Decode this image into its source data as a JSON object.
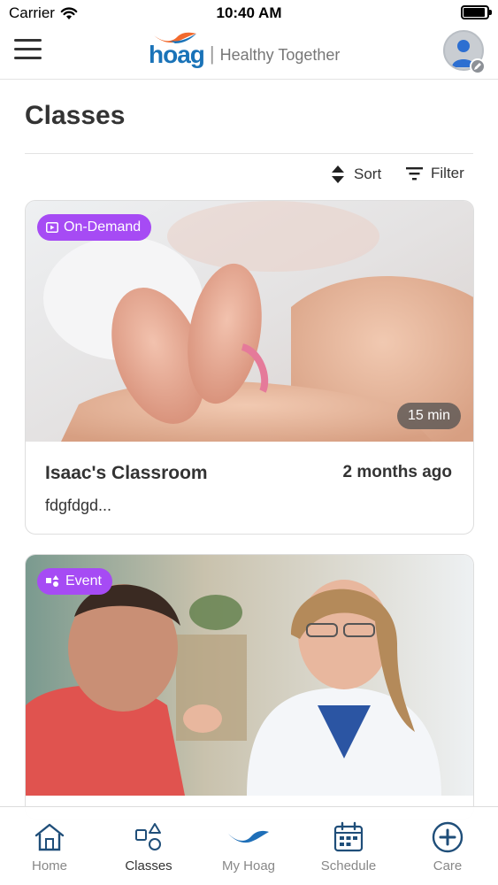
{
  "status_bar": {
    "carrier": "Carrier",
    "time": "10:40 AM"
  },
  "header": {
    "brand_name": "hoag",
    "brand_divider": "|",
    "tagline": "Healthy Together",
    "icons": {
      "menu": "hamburger-menu-icon",
      "avatar": "user-avatar-icon",
      "edit": "pencil-icon"
    }
  },
  "page": {
    "title": "Classes",
    "sort_label": "Sort",
    "filter_label": "Filter"
  },
  "cards": [
    {
      "badge": "On-Demand",
      "badge_icon": "video-play-icon",
      "duration": "15 min",
      "title": "Isaac's Classroom",
      "time_ago": "2 months ago",
      "description": "fdgfdgd..."
    },
    {
      "badge": "Event",
      "badge_icon": "shapes-icon"
    }
  ],
  "tabs": [
    {
      "label": "Home",
      "icon": "home-icon",
      "active": false
    },
    {
      "label": "Classes",
      "icon": "shapes-icon",
      "active": true
    },
    {
      "label": "My Hoag",
      "icon": "hoag-swoosh-icon",
      "active": false
    },
    {
      "label": "Schedule",
      "icon": "calendar-icon",
      "active": false
    },
    {
      "label": "Care",
      "icon": "plus-circle-icon",
      "active": false
    }
  ],
  "colors": {
    "badge": "#a64bf4",
    "brand_blue": "#1a73b8",
    "brand_orange": "#f26a2e",
    "tab_icon": "#1f4e79"
  }
}
